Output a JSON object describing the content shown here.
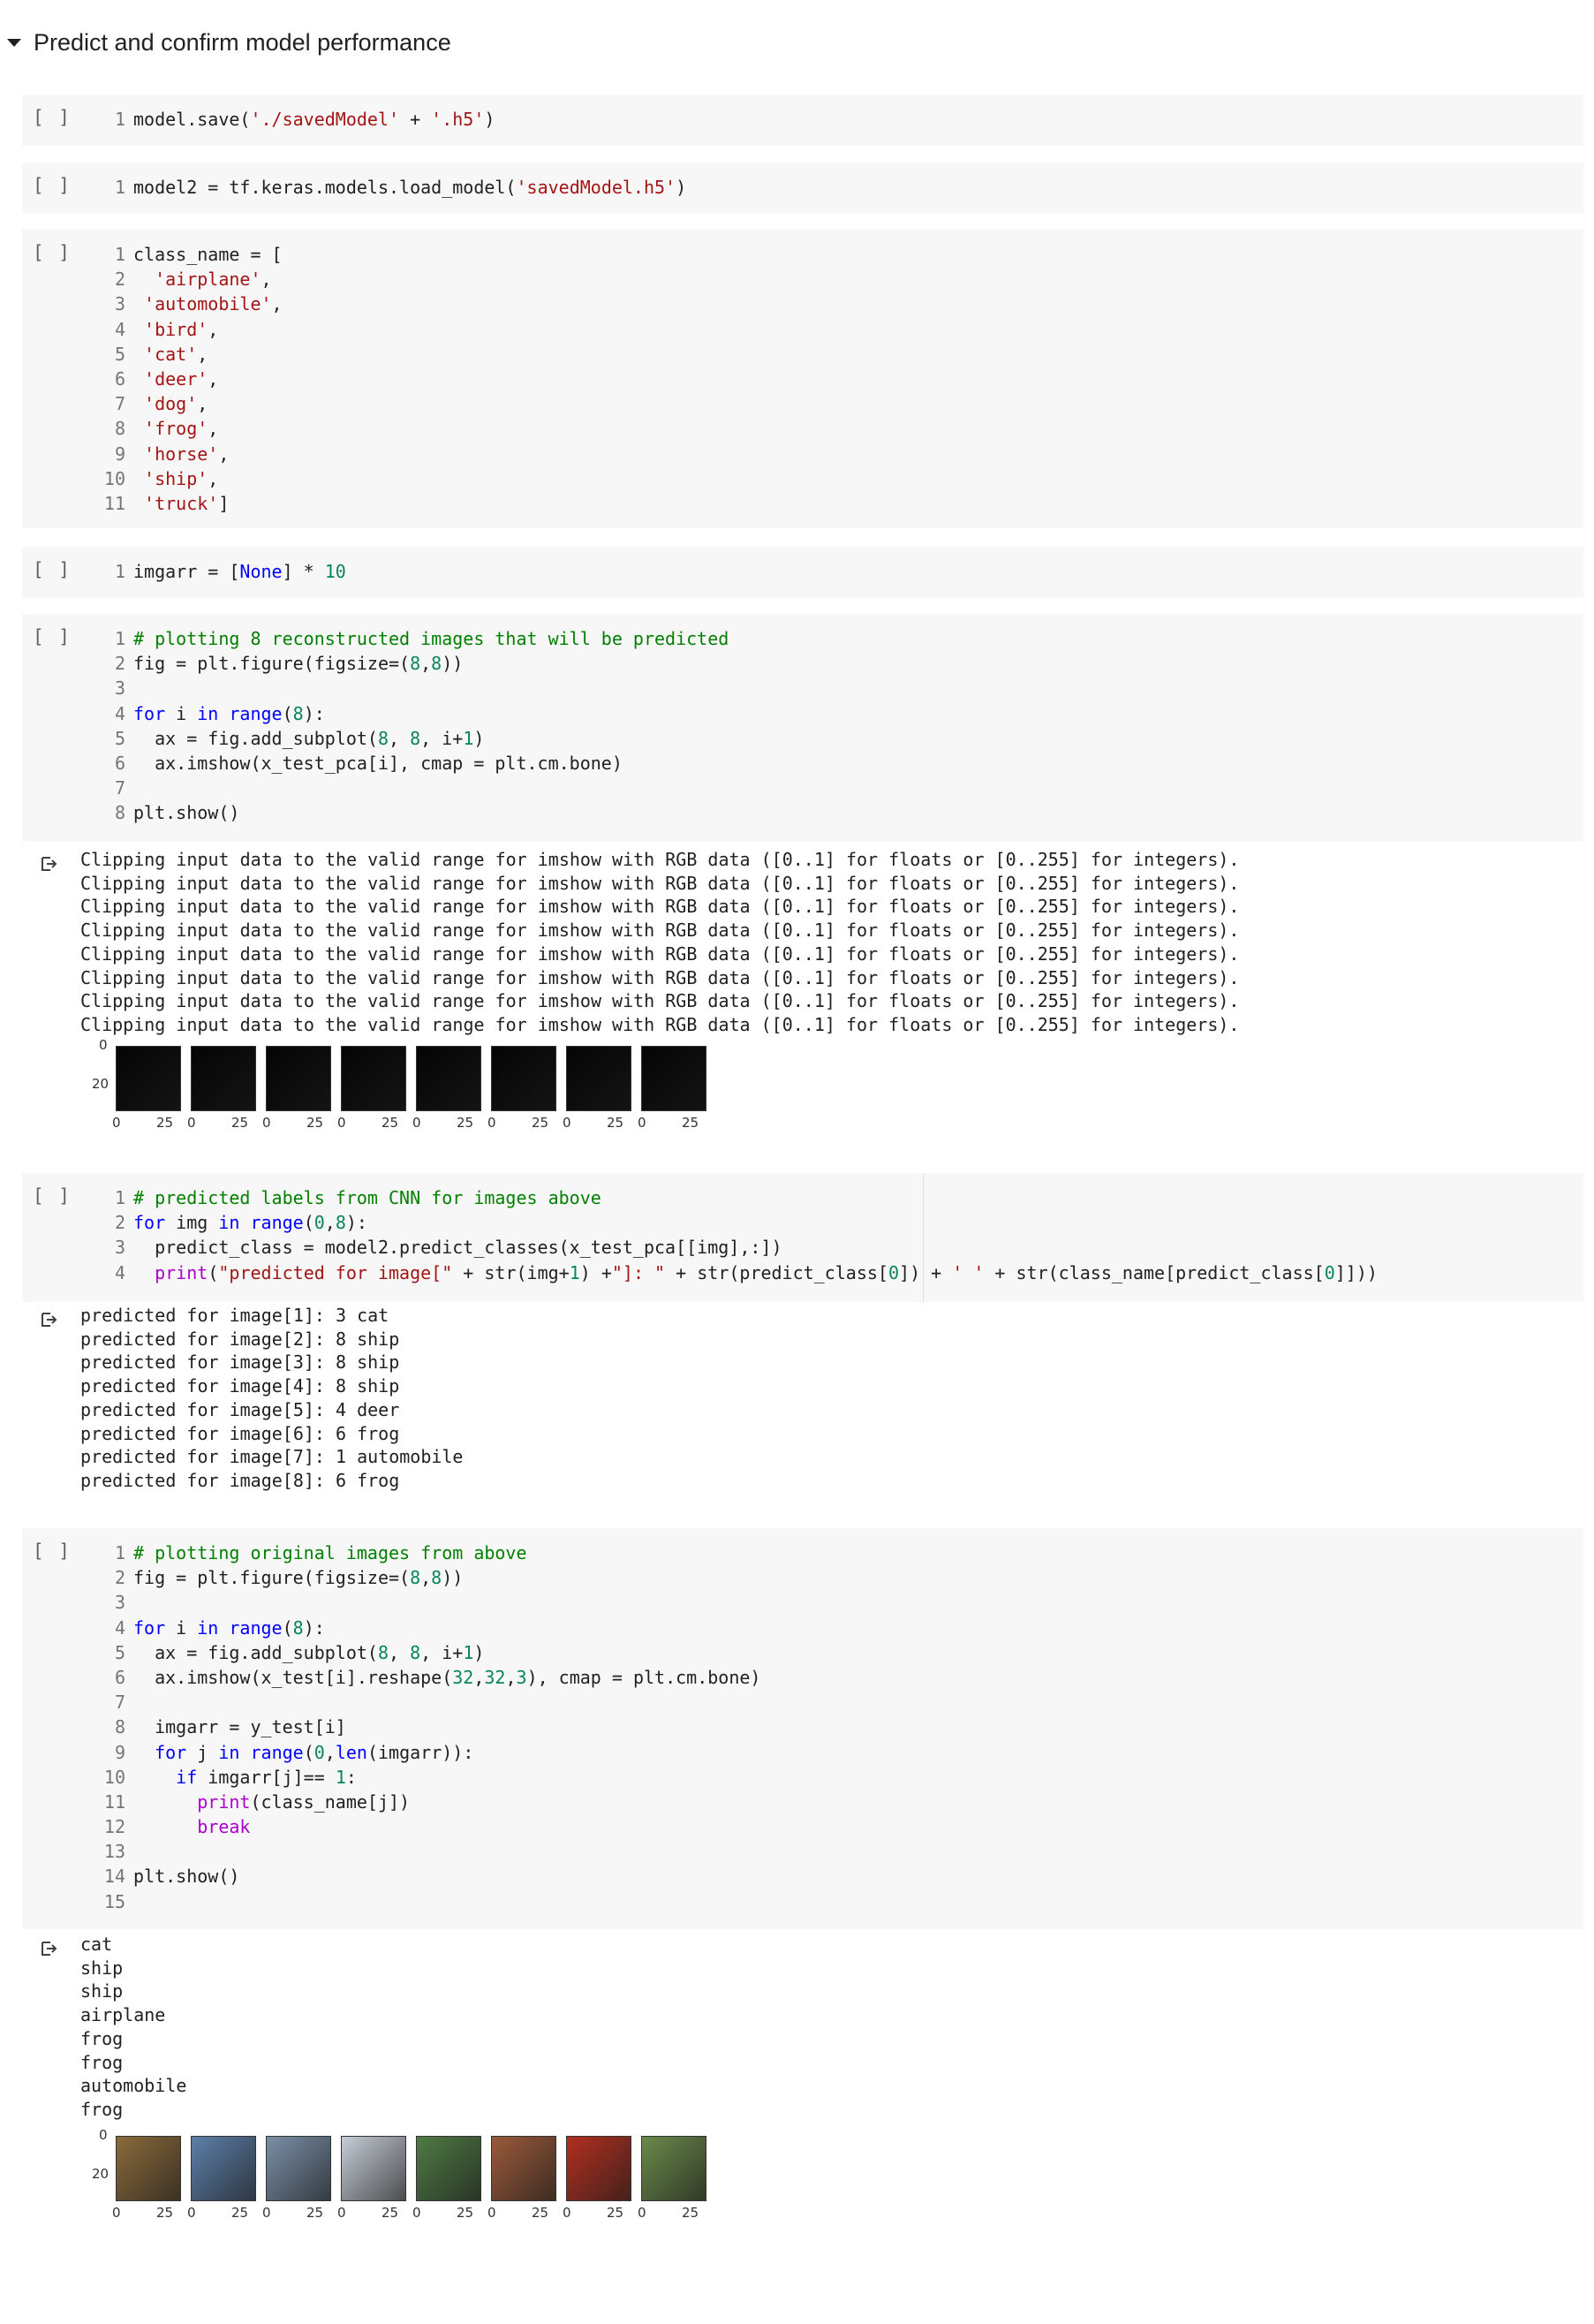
{
  "section": {
    "title": "Predict and confirm model performance"
  },
  "run_button": "[ ]",
  "cells": [
    {
      "lines": [
        [
          [
            "1",
            "n"
          ],
          [
            "model.save(",
            "t"
          ],
          [
            "'./savedModel'",
            "s"
          ],
          [
            " + ",
            "t"
          ],
          [
            "'.h5'",
            "s"
          ],
          [
            ")",
            "t"
          ]
        ]
      ]
    },
    {
      "lines": [
        [
          [
            "1",
            "n"
          ],
          [
            "model2 = tf.keras.models.load_model(",
            "t"
          ],
          [
            "'savedModel.h5'",
            "s"
          ],
          [
            ")",
            "t"
          ]
        ]
      ]
    },
    {
      "lines": [
        [
          [
            "1",
            "n"
          ],
          [
            "class_name = [",
            "t"
          ]
        ],
        [
          [
            "2",
            "n"
          ],
          [
            "  ",
            "t"
          ],
          [
            "'airplane'",
            "s"
          ],
          [
            ",",
            "t"
          ]
        ],
        [
          [
            "3",
            "n"
          ],
          [
            " ",
            "t"
          ],
          [
            "'automobile'",
            "s"
          ],
          [
            ",",
            "t"
          ]
        ],
        [
          [
            "4",
            "n"
          ],
          [
            " ",
            "t"
          ],
          [
            "'bird'",
            "s"
          ],
          [
            ",",
            "t"
          ]
        ],
        [
          [
            "5",
            "n"
          ],
          [
            " ",
            "t"
          ],
          [
            "'cat'",
            "s"
          ],
          [
            ",",
            "t"
          ]
        ],
        [
          [
            "6",
            "n"
          ],
          [
            " ",
            "t"
          ],
          [
            "'deer'",
            "s"
          ],
          [
            ",",
            "t"
          ]
        ],
        [
          [
            "7",
            "n"
          ],
          [
            " ",
            "t"
          ],
          [
            "'dog'",
            "s"
          ],
          [
            ",",
            "t"
          ]
        ],
        [
          [
            "8",
            "n"
          ],
          [
            " ",
            "t"
          ],
          [
            "'frog'",
            "s"
          ],
          [
            ",",
            "t"
          ]
        ],
        [
          [
            "9",
            "n"
          ],
          [
            " ",
            "t"
          ],
          [
            "'horse'",
            "s"
          ],
          [
            ",",
            "t"
          ]
        ],
        [
          [
            "10",
            "n"
          ],
          [
            " ",
            "t"
          ],
          [
            "'ship'",
            "s"
          ],
          [
            ",",
            "t"
          ]
        ],
        [
          [
            "11",
            "n"
          ],
          [
            " ",
            "t"
          ],
          [
            "'truck'",
            "s"
          ],
          [
            "]",
            "t"
          ]
        ]
      ]
    },
    {
      "lines": [
        [
          [
            "1",
            "n"
          ],
          [
            "imgarr = [",
            "t"
          ],
          [
            "None",
            "k"
          ],
          [
            "] * ",
            "t"
          ],
          [
            "10",
            "d"
          ]
        ]
      ]
    },
    {
      "lines": [
        [
          [
            "1",
            "n"
          ],
          [
            "# plotting 8 reconstructed images that will be predicted",
            "c"
          ]
        ],
        [
          [
            "2",
            "n"
          ],
          [
            "fig = plt.figure(figsize=(",
            "t"
          ],
          [
            "8",
            "d"
          ],
          [
            ",",
            "t"
          ],
          [
            "8",
            "d"
          ],
          [
            "))",
            "t"
          ]
        ],
        [
          [
            "3",
            "n"
          ]
        ],
        [
          [
            "4",
            "n"
          ],
          [
            "for",
            "k"
          ],
          [
            " i ",
            "t"
          ],
          [
            "in",
            "k"
          ],
          [
            " ",
            "t"
          ],
          [
            "range",
            "k"
          ],
          [
            "(",
            "t"
          ],
          [
            "8",
            "d"
          ],
          [
            "):",
            "t"
          ]
        ],
        [
          [
            "5",
            "n"
          ],
          [
            "  ax = fig.add_subplot(",
            "t"
          ],
          [
            "8",
            "d"
          ],
          [
            ", ",
            "t"
          ],
          [
            "8",
            "d"
          ],
          [
            ", i+",
            "t"
          ],
          [
            "1",
            "d"
          ],
          [
            ")",
            "t"
          ]
        ],
        [
          [
            "6",
            "n"
          ],
          [
            "  ax.imshow(x_test_pca[i], cmap = plt.cm.bone)",
            "t"
          ]
        ],
        [
          [
            "7",
            "n"
          ]
        ],
        [
          [
            "8",
            "n"
          ],
          [
            "plt.show()",
            "t"
          ]
        ]
      ]
    },
    {
      "lines": [
        [
          [
            "1",
            "n"
          ],
          [
            "# predicted labels from CNN for images above",
            "c"
          ]
        ],
        [
          [
            "2",
            "n"
          ],
          [
            "for",
            "k"
          ],
          [
            " img ",
            "t"
          ],
          [
            "in",
            "k"
          ],
          [
            " ",
            "t"
          ],
          [
            "range",
            "k"
          ],
          [
            "(",
            "t"
          ],
          [
            "0",
            "d"
          ],
          [
            ",",
            "t"
          ],
          [
            "8",
            "d"
          ],
          [
            "):",
            "t"
          ]
        ],
        [
          [
            "3",
            "n"
          ],
          [
            "  predict_class = model2.predict_classes(x_test_pca[[img],:])",
            "t"
          ]
        ],
        [
          [
            "4",
            "n"
          ],
          [
            "  ",
            "t"
          ],
          [
            "print",
            "k2"
          ],
          [
            "(",
            "t"
          ],
          [
            "\"predicted for image[\"",
            "s"
          ],
          [
            " + str(img+",
            "t"
          ],
          [
            "1",
            "d"
          ],
          [
            ") +",
            "t"
          ],
          [
            "\"]: \"",
            "s"
          ],
          [
            " + str(predict_class[",
            "t"
          ],
          [
            "0",
            "d"
          ],
          [
            "]) + ",
            "t"
          ],
          [
            "' '",
            "s"
          ],
          [
            " + str(class_name[predict_class[",
            "t"
          ],
          [
            "0",
            "d"
          ],
          [
            "]]))",
            "t"
          ]
        ]
      ]
    },
    {
      "lines": [
        [
          [
            "1",
            "n"
          ],
          [
            "# plotting original images from above",
            "c"
          ]
        ],
        [
          [
            "2",
            "n"
          ],
          [
            "fig = plt.figure(figsize=(",
            "t"
          ],
          [
            "8",
            "d"
          ],
          [
            ",",
            "t"
          ],
          [
            "8",
            "d"
          ],
          [
            "))",
            "t"
          ]
        ],
        [
          [
            "3",
            "n"
          ]
        ],
        [
          [
            "4",
            "n"
          ],
          [
            "for",
            "k"
          ],
          [
            " i ",
            "t"
          ],
          [
            "in",
            "k"
          ],
          [
            " ",
            "t"
          ],
          [
            "range",
            "k"
          ],
          [
            "(",
            "t"
          ],
          [
            "8",
            "d"
          ],
          [
            "):",
            "t"
          ]
        ],
        [
          [
            "5",
            "n"
          ],
          [
            "  ax = fig.add_subplot(",
            "t"
          ],
          [
            "8",
            "d"
          ],
          [
            ", ",
            "t"
          ],
          [
            "8",
            "d"
          ],
          [
            ", i+",
            "t"
          ],
          [
            "1",
            "d"
          ],
          [
            ")",
            "t"
          ]
        ],
        [
          [
            "6",
            "n"
          ],
          [
            "  ax.imshow(x_test[i].reshape(",
            "t"
          ],
          [
            "32",
            "d"
          ],
          [
            ",",
            "t"
          ],
          [
            "32",
            "d"
          ],
          [
            ",",
            "t"
          ],
          [
            "3",
            "d"
          ],
          [
            "), cmap = plt.cm.bone)",
            "t"
          ]
        ],
        [
          [
            "7",
            "n"
          ]
        ],
        [
          [
            "8",
            "n"
          ],
          [
            "  imgarr = y_test[i]",
            "t"
          ]
        ],
        [
          [
            "9",
            "n"
          ],
          [
            "  ",
            "t"
          ],
          [
            "for",
            "k"
          ],
          [
            " j ",
            "t"
          ],
          [
            "in",
            "k"
          ],
          [
            " ",
            "t"
          ],
          [
            "range",
            "k"
          ],
          [
            "(",
            "t"
          ],
          [
            "0",
            "d"
          ],
          [
            ",",
            "t"
          ],
          [
            "len",
            "k"
          ],
          [
            "(imgarr)):",
            "t"
          ]
        ],
        [
          [
            "10",
            "n"
          ],
          [
            "    ",
            "t"
          ],
          [
            "if",
            "k"
          ],
          [
            " imgarr[j]== ",
            "t"
          ],
          [
            "1",
            "d"
          ],
          [
            ":",
            "t"
          ]
        ],
        [
          [
            "11",
            "n"
          ],
          [
            "      ",
            "t"
          ],
          [
            "print",
            "k2"
          ],
          [
            "(class_name[j])",
            "t"
          ]
        ],
        [
          [
            "12",
            "n"
          ],
          [
            "      ",
            "t"
          ],
          [
            "break",
            "k2"
          ]
        ],
        [
          [
            "13",
            "n"
          ]
        ],
        [
          [
            "14",
            "n"
          ],
          [
            "plt.show()",
            "t"
          ]
        ],
        [
          [
            "15",
            "n"
          ]
        ]
      ]
    }
  ],
  "outputs": {
    "clipping": [
      "Clipping input data to the valid range for imshow with RGB data ([0..1] for floats or [0..255] for integers).",
      "Clipping input data to the valid range for imshow with RGB data ([0..1] for floats or [0..255] for integers).",
      "Clipping input data to the valid range for imshow with RGB data ([0..1] for floats or [0..255] for integers).",
      "Clipping input data to the valid range for imshow with RGB data ([0..1] for floats or [0..255] for integers).",
      "Clipping input data to the valid range for imshow with RGB data ([0..1] for floats or [0..255] for integers).",
      "Clipping input data to the valid range for imshow with RGB data ([0..1] for floats or [0..255] for integers).",
      "Clipping input data to the valid range for imshow with RGB data ([0..1] for floats or [0..255] for integers).",
      "Clipping input data to the valid range for imshow with RGB data ([0..1] for floats or [0..255] for integers)."
    ],
    "predictions": [
      "predicted for image[1]: 3 cat",
      "predicted for image[2]: 8 ship",
      "predicted for image[3]: 8 ship",
      "predicted for image[4]: 8 ship",
      "predicted for image[5]: 4 deer",
      "predicted for image[6]: 6 frog",
      "predicted for image[7]: 1 automobile",
      "predicted for image[8]: 6 frog"
    ],
    "labels": [
      "cat",
      "ship",
      "ship",
      "airplane",
      "frog",
      "frog",
      "automobile",
      "frog"
    ]
  },
  "plot_ticks": {
    "y_top": "0",
    "y_mid": "20",
    "x_left": "0",
    "x_right": "25"
  },
  "image_colors": {
    "reconstructed": "#050505",
    "original": [
      "#8a6a3a",
      "#5d7fa8",
      "#7a8fa6",
      "#c6ccd6",
      "#4f7a44",
      "#9a5a3a",
      "#b03020",
      "#6a8a4a"
    ]
  }
}
